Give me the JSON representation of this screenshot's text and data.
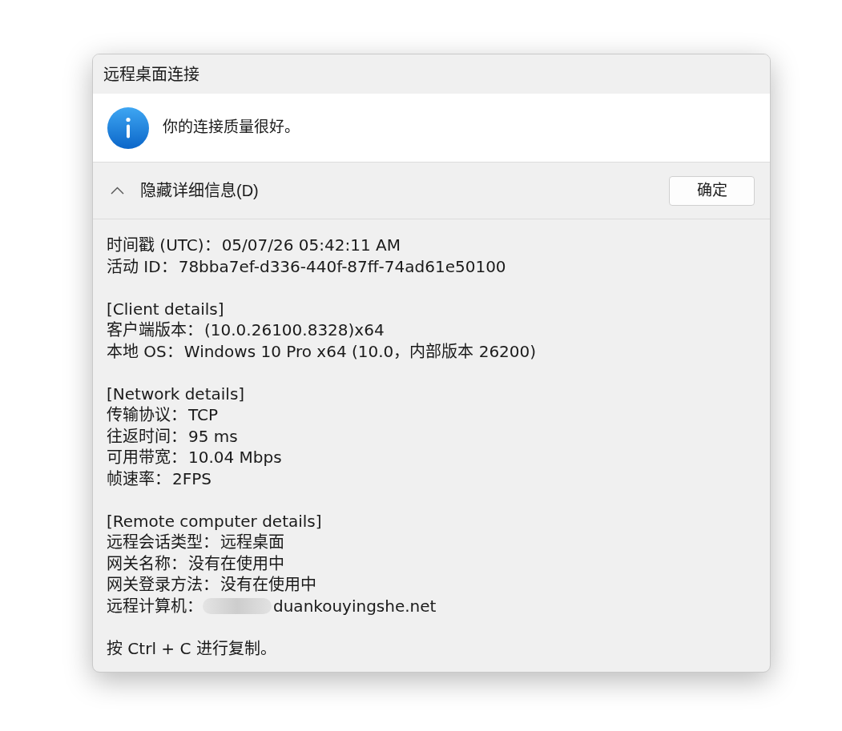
{
  "window": {
    "title": "远程桌面连接"
  },
  "message": {
    "kind": "info",
    "text": "你的连接质量很好。"
  },
  "details_toggle": {
    "label": "隐藏详细信息(D)",
    "expanded": true
  },
  "buttons": [
    {
      "label": "确定"
    }
  ],
  "details": {
    "groups": [
      {
        "lines": [
          {
            "label": "时间戳 (UTC)：",
            "value": "05/07/26 05:42:11 AM"
          },
          {
            "label": "活动 ID：",
            "value": "78bba7ef-d336-440f-87ff-74ad61e50100"
          }
        ]
      },
      {
        "heading": "[Client details]",
        "lines": [
          {
            "label": "客户端版本：",
            "value": "(10.0.26100.8328)x64"
          },
          {
            "label": "本地 OS：",
            "value": "Windows 10 Pro x64 (10.0，内部版本 26200)"
          }
        ]
      },
      {
        "heading": "[Network details]",
        "lines": [
          {
            "label": "传输协议：",
            "value": "TCP"
          },
          {
            "label": "往返时间：",
            "value": "95 ms"
          },
          {
            "label": "可用带宽：",
            "value": "10.04 Mbps"
          },
          {
            "label": "帧速率：",
            "value": "2FPS"
          }
        ]
      },
      {
        "heading": "[Remote computer details]",
        "lines": [
          {
            "label": "远程会话类型：",
            "value": "远程桌面"
          },
          {
            "label": "网关名称：",
            "value": "没有在使用中"
          },
          {
            "label": "网关登录方法：",
            "value": "没有在使用中"
          },
          {
            "label": "远程计算机：",
            "value": "duankouyingshe.net",
            "redacted": true
          }
        ]
      }
    ],
    "footer": "按 Ctrl + C 进行复制。"
  }
}
